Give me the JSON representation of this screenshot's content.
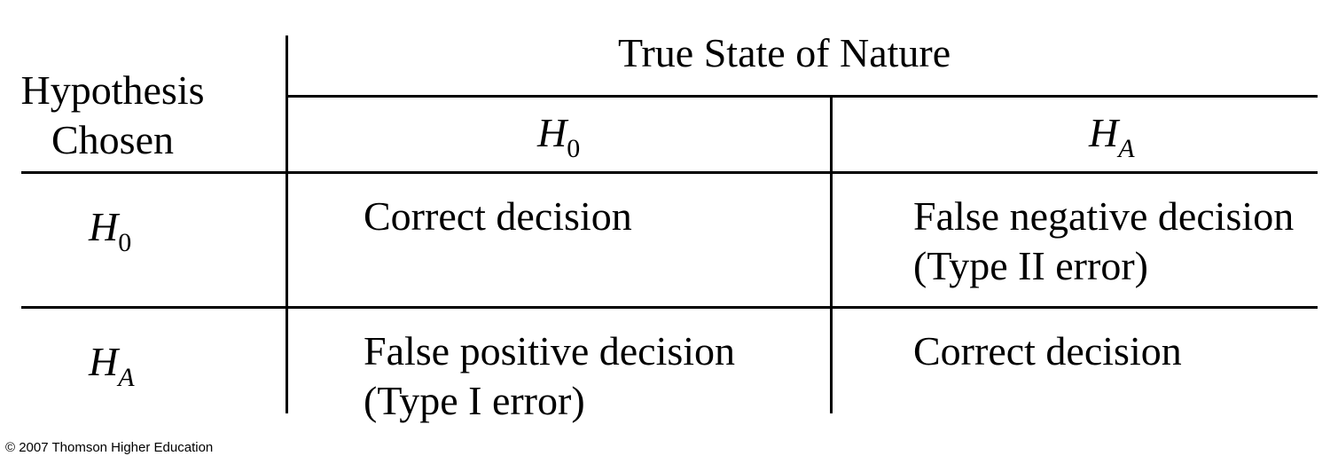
{
  "table": {
    "header_group": "True State of Nature",
    "row_header_line1": "Hypothesis",
    "row_header_line2": "Chosen",
    "columns": [
      {
        "symbol": "H",
        "subscript": "0"
      },
      {
        "symbol": "H",
        "subscript": "A"
      }
    ],
    "rows": [
      {
        "symbol": "H",
        "subscript": "0",
        "cells": [
          {
            "line1": "Correct decision",
            "line2": ""
          },
          {
            "line1": "False negative decision",
            "line2": "(Type II error)"
          }
        ]
      },
      {
        "symbol": "H",
        "subscript": "A",
        "cells": [
          {
            "line1": "False positive decision",
            "line2": "(Type I error)"
          },
          {
            "line1": "Correct decision",
            "line2": ""
          }
        ]
      }
    ]
  },
  "footer": {
    "copyright": "© 2007 Thomson Higher Education"
  }
}
